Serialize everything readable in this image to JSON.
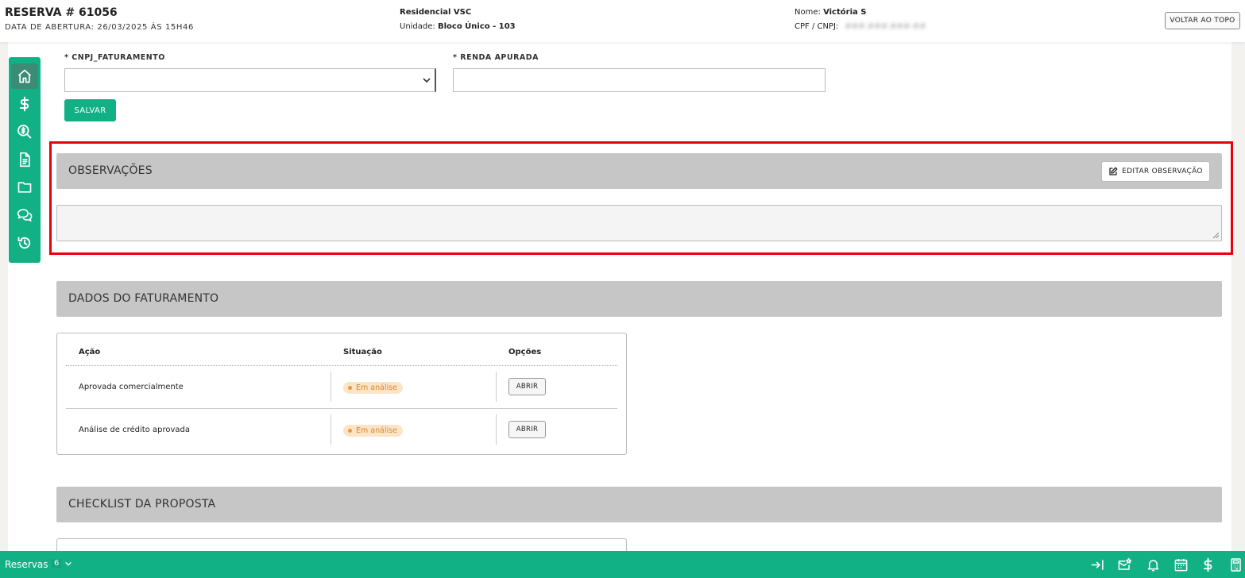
{
  "header": {
    "reserva_title": "RESERVA # 61056",
    "abertura": "DATA DE ABERTURA: 26/03/2025 ÀS 15H46",
    "empreendimento": "Residencial VSC",
    "unidade_label": "Unidade:",
    "unidade_value": "Bloco Único - 103",
    "nome_label": "Nome:",
    "nome_value": "Victória S",
    "cpf_label": "CPF / CNPJ:",
    "cpf_value": "###.###.###-##",
    "voltar_label": "VOLTAR AO TOPO"
  },
  "sidenav": {
    "items": [
      {
        "icon": "home-icon",
        "active": true
      },
      {
        "icon": "dollar-icon",
        "active": false
      },
      {
        "icon": "search-dollar-icon",
        "active": false
      },
      {
        "icon": "document-icon",
        "active": false
      },
      {
        "icon": "folder-icon",
        "active": false
      },
      {
        "icon": "chat-icon",
        "active": false
      },
      {
        "icon": "history-icon",
        "active": false
      }
    ]
  },
  "form": {
    "cnpj_label": "* CNPJ_FATURAMENTO",
    "cnpj_value": "",
    "renda_label": "* RENDA APURADA",
    "renda_value": "",
    "salvar_label": "SALVAR"
  },
  "observacoes": {
    "title": "OBSERVAÇÕES",
    "editar_label": "EDITAR OBSERVAÇÃO",
    "text": ""
  },
  "faturamento": {
    "title": "DADOS DO FATURAMENTO",
    "columns": [
      "Ação",
      "Situação",
      "Opções"
    ],
    "rows": [
      {
        "acao": "Aprovada comercialmente",
        "situacao": "Em análise",
        "opcao": "ABRIR"
      },
      {
        "acao": "Análise de crédito aprovada",
        "situacao": "Em análise",
        "opcao": "ABRIR"
      }
    ]
  },
  "checklist": {
    "title": "CHECKLIST DA PROPOSTA"
  },
  "bottombar": {
    "label": "Reservas",
    "count": "6",
    "icons": [
      "login-arrow-icon",
      "mail-star-icon",
      "bell-icon",
      "calendar-icon",
      "dollar-icon",
      "calculator-icon"
    ]
  },
  "colors": {
    "brand_green": "#12b085",
    "active_green": "#3c8b74",
    "section_gray": "#c6c6c6",
    "highlight_red": "#e8000b",
    "badge_bg": "#fbe4c8",
    "badge_text": "#d98a2b"
  }
}
